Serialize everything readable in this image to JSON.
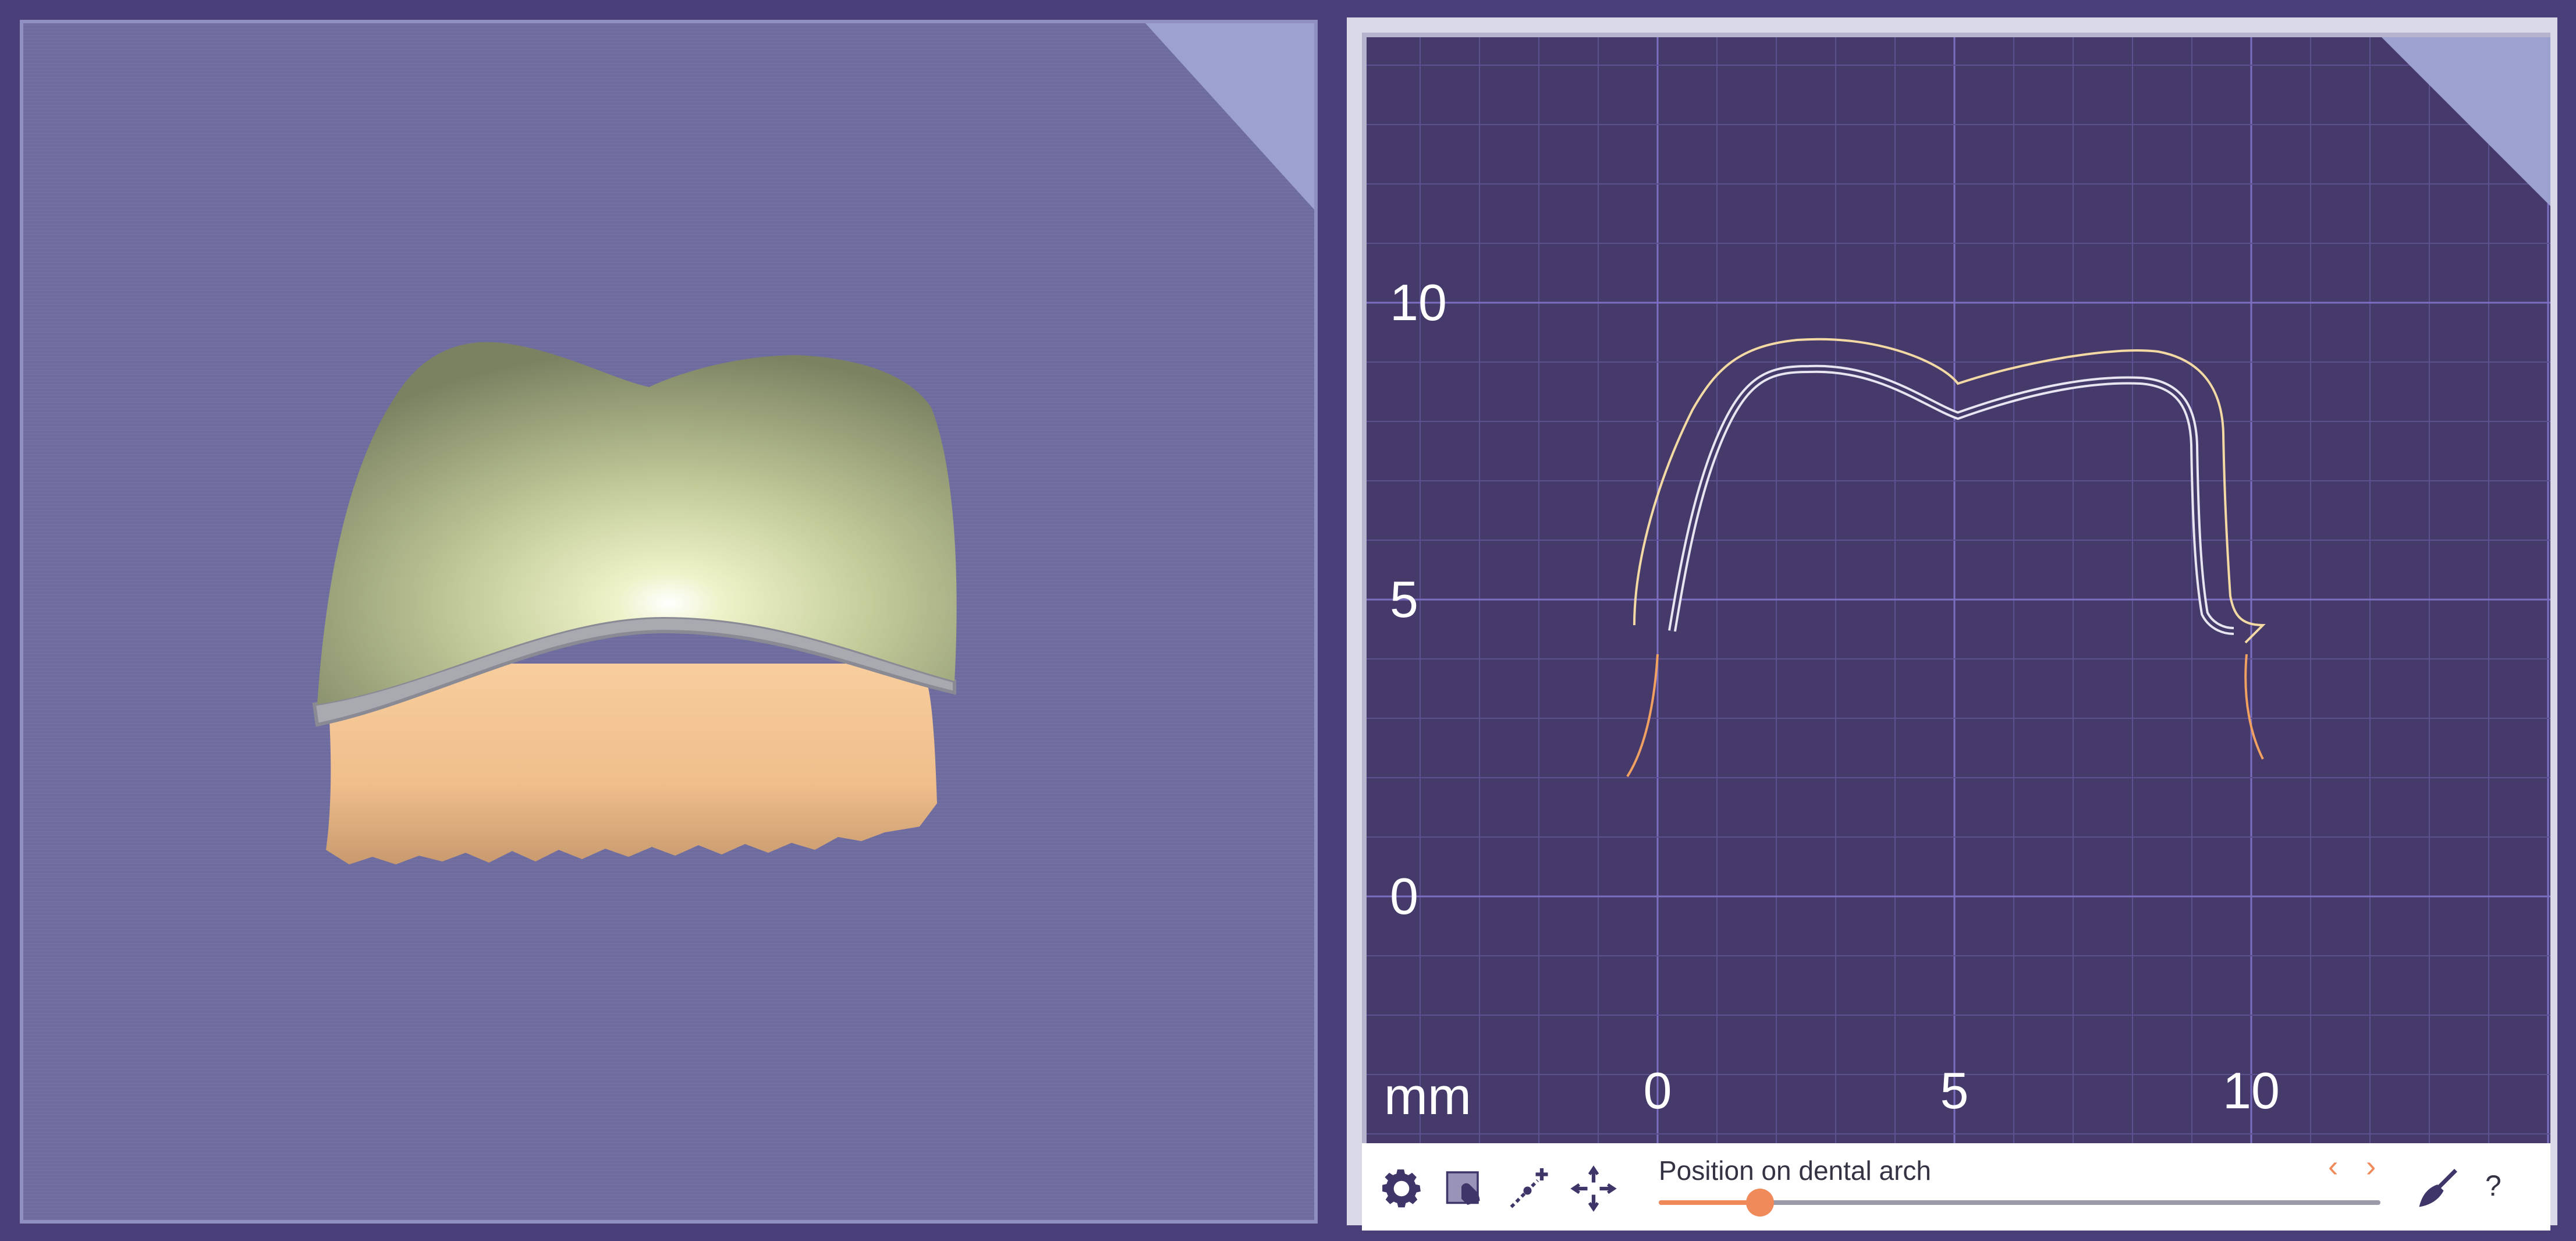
{
  "viewport3d": {
    "colors": {
      "background": "#6e6c9e",
      "crown": "#c9d1a5",
      "gingiva": "#f1c18f"
    }
  },
  "section_view": {
    "axis_unit": "mm",
    "x_ticks": [
      0,
      5,
      10
    ],
    "y_ticks": [
      10,
      5,
      0
    ],
    "colors": {
      "background": "#463a6b",
      "outer_contour": "#f3d9a3",
      "inner_contour": "#e8e4f0",
      "margin_line": "#f0a060"
    }
  },
  "toolbar": {
    "settings_icon": "gear-icon",
    "view_icon": "hand-view-icon",
    "add_point_icon": "add-point-icon",
    "center_icon": "crosshair-icon",
    "slider_label": "Position on dental arch",
    "slider_value": 0.14,
    "prev_label": "‹",
    "next_label": "›",
    "clean_icon": "broom-icon",
    "help_label": "?",
    "accent_color": "#f08a5a"
  }
}
